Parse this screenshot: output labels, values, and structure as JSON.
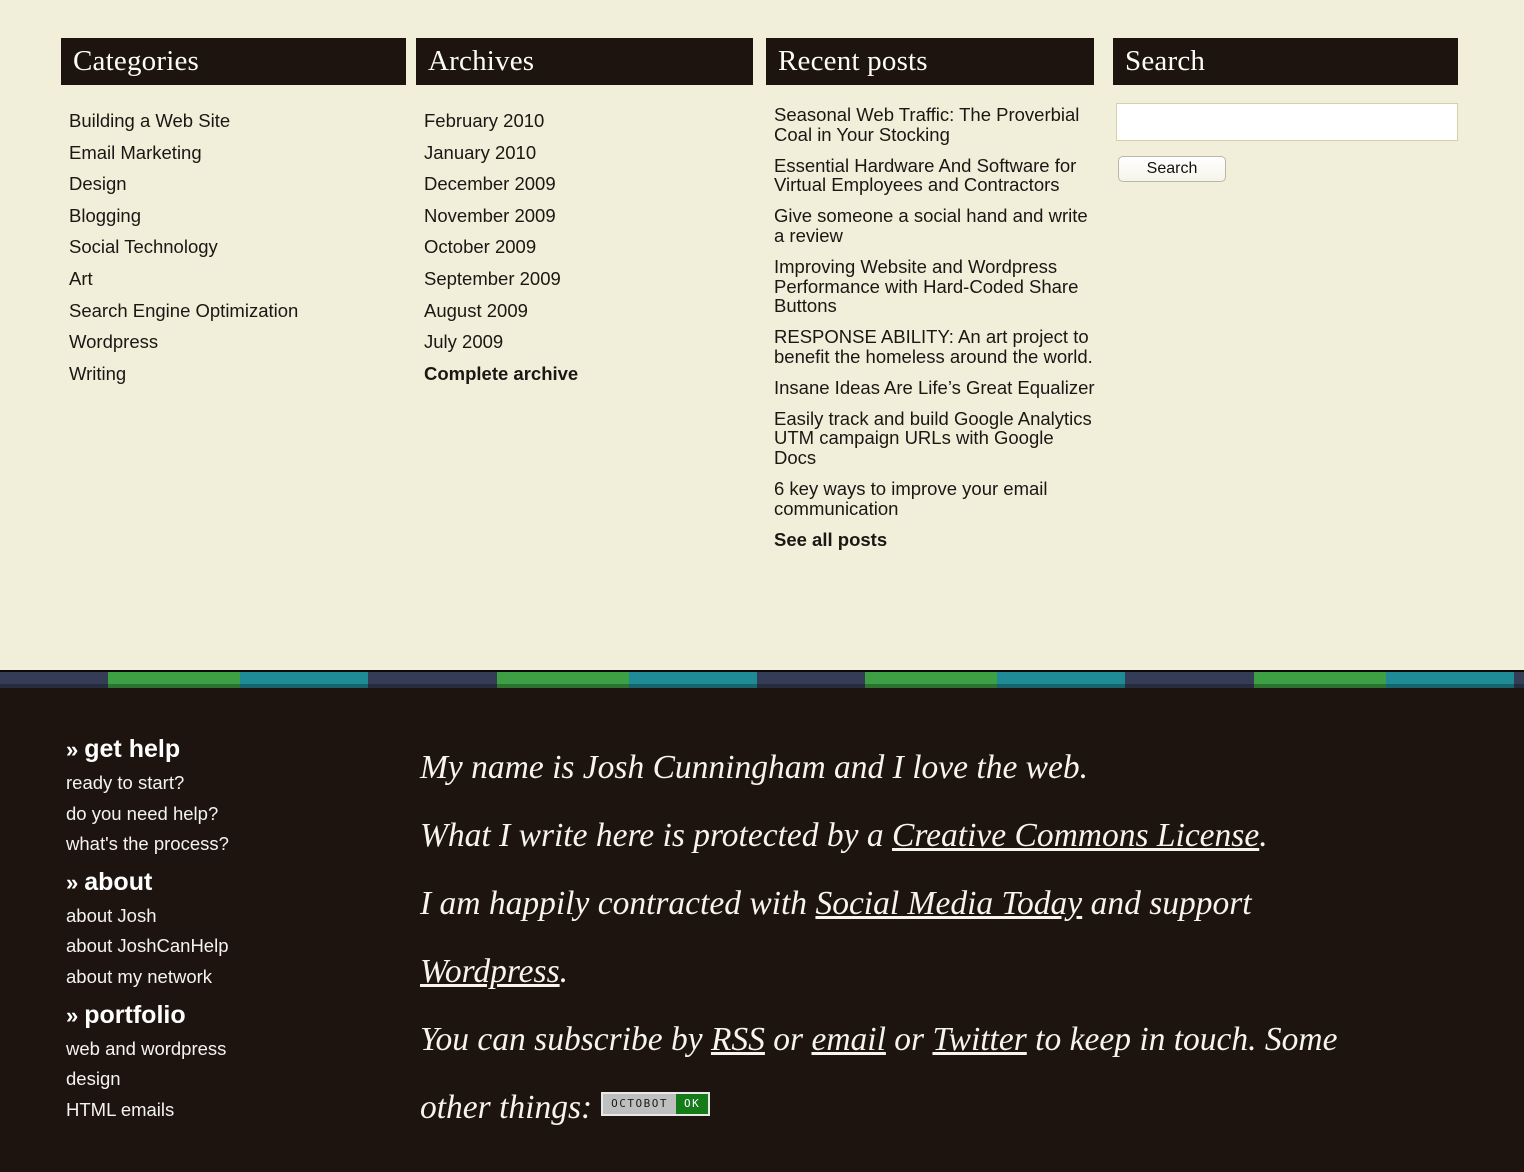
{
  "widgets": {
    "categories": {
      "title": "Categories",
      "items": [
        {
          "label": "Building a Web Site",
          "strong": false
        },
        {
          "label": "Email Marketing",
          "strong": false
        },
        {
          "label": "Design",
          "strong": false
        },
        {
          "label": "Blogging",
          "strong": false
        },
        {
          "label": "Social Technology",
          "strong": false
        },
        {
          "label": "Art",
          "strong": false
        },
        {
          "label": "Search Engine Optimization",
          "strong": false
        },
        {
          "label": "Wordpress",
          "strong": false
        },
        {
          "label": "Writing",
          "strong": false
        }
      ]
    },
    "archives": {
      "title": "Archives",
      "items": [
        {
          "label": "February 2010",
          "strong": false
        },
        {
          "label": "January 2010",
          "strong": false
        },
        {
          "label": "December 2009",
          "strong": false
        },
        {
          "label": "November 2009",
          "strong": false
        },
        {
          "label": "October 2009",
          "strong": false
        },
        {
          "label": "September 2009",
          "strong": false
        },
        {
          "label": "August 2009",
          "strong": false
        },
        {
          "label": "July 2009",
          "strong": false
        },
        {
          "label": "Complete archive",
          "strong": true
        }
      ]
    },
    "recent_posts": {
      "title": "Recent posts",
      "items": [
        {
          "label": "Seasonal Web Traffic: The Proverbial Coal in Your Stocking",
          "strong": false
        },
        {
          "label": "Essential Hardware And Software for Virtual Employees and Contractors",
          "strong": false
        },
        {
          "label": "Give someone a social hand and write a review",
          "strong": false
        },
        {
          "label": "Improving Website and Wordpress Performance with Hard-Coded Share Buttons",
          "strong": false
        },
        {
          "label": "RESPONSE ABILITY: An art project to benefit the homeless around the world.",
          "strong": false
        },
        {
          "label": "Insane Ideas Are Life’s Great Equalizer",
          "strong": false
        },
        {
          "label": "Easily track and build Google Analytics UTM campaign URLs with Google Docs",
          "strong": false
        },
        {
          "label": "6 key ways to improve your email communication",
          "strong": false
        },
        {
          "label": "See all posts",
          "strong": true
        }
      ]
    },
    "search": {
      "title": "Search",
      "input_value": "",
      "input_placeholder": "",
      "button_label": "Search"
    }
  },
  "footer": {
    "nav": [
      {
        "heading": "get help",
        "chevron": "»",
        "links": [
          "ready to start?",
          "do you need help?",
          "what's the process?"
        ]
      },
      {
        "heading": "about",
        "chevron": "»",
        "links": [
          "about Josh",
          "about JoshCanHelp",
          "about my network"
        ]
      },
      {
        "heading": "portfolio",
        "chevron": "»",
        "links": [
          "web and wordpress",
          "design",
          "HTML emails"
        ]
      }
    ],
    "about": {
      "line1": "My name is Josh Cunningham and I love the web.",
      "line2_a": "What I write here is protected by a ",
      "line2_link": "Creative Commons License",
      "line2_b": ".",
      "line3_a": "I am happily contracted with ",
      "line3_link": "Social Media Today",
      "line3_b": " and support",
      "line4_link": "Wordpress",
      "line4_b": ".",
      "line5_a": "You can subscribe by ",
      "line5_link1": "RSS",
      "line5_mid1": " or ",
      "line5_link2": "email",
      "line5_mid2": " or ",
      "line5_link3": "Twitter",
      "line5_b": " to keep in touch. Some",
      "line6_a": "other things:",
      "badge_left": "OCTOBOT",
      "badge_right": "OK"
    }
  },
  "colors": {
    "page_bg": "#f1eeda",
    "header_bar": "#1d1410",
    "footer_bg": "#1d1410",
    "stripe_navy": "#353c56",
    "stripe_green": "#3da045",
    "stripe_teal": "#1f8b96",
    "badge_green": "#157a18"
  }
}
